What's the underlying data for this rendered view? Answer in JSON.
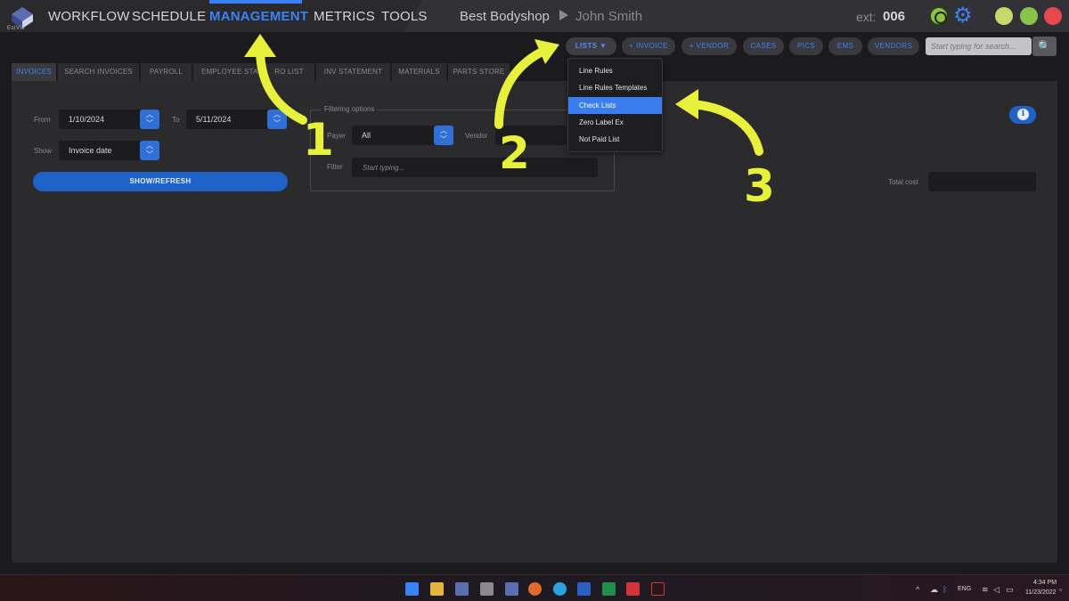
{
  "brand": {
    "logo_text": "EstVis"
  },
  "nav": {
    "items": [
      {
        "label": "WORKFLOW"
      },
      {
        "label": "SCHEDULE"
      },
      {
        "label": "MANAGEMENT"
      },
      {
        "label": "METRICS"
      },
      {
        "label": "TOOLS"
      }
    ],
    "active": "MANAGEMENT"
  },
  "header": {
    "shop": "Best Bodyshop",
    "user": "John Smith",
    "ext_label": "ext:",
    "ext_value": "006"
  },
  "toolbar": {
    "lists_label": "LISTS ▼",
    "invoice_label": "+ INVOICE",
    "vendor_label": "+ VENDOR",
    "cases_label": "CASES",
    "pics_label": "PICS",
    "ems_label": "EMS",
    "vendors_label": "VENDORS",
    "search_placeholder": "Start typing for search...",
    "search_icon": "🔍"
  },
  "tabs": [
    {
      "label": "INVOICES"
    },
    {
      "label": "SEARCH INVOICES"
    },
    {
      "label": "PAYROLL"
    },
    {
      "label": "EMPLOYEE STAT..."
    },
    {
      "label": "RO LIST"
    },
    {
      "label": "INV STATEMENT"
    },
    {
      "label": "MATERIALS"
    },
    {
      "label": "PARTS STORE"
    }
  ],
  "form": {
    "from_label": "From",
    "from_value": "1/10/2024",
    "to_label": "To",
    "to_value": "5/11/2024",
    "show_label": "Show",
    "show_value": "Invoice date",
    "show_button": "SHOW/REFRESH",
    "filtering_title": "Filtering options",
    "payer_label": "Payer",
    "payer_value": "All",
    "vendor_label": "Vendor",
    "filter_label": "Filter",
    "filter_placeholder": "Start typing...",
    "total_cost_label": "Total cost"
  },
  "lists_menu": {
    "items": [
      {
        "label": "Line Rules"
      },
      {
        "label": "Line Rules Templates"
      },
      {
        "label": "Check Lists"
      },
      {
        "label": "Zero Label Ex"
      },
      {
        "label": "Not Paid List"
      }
    ],
    "selected": "Check Lists"
  },
  "annotations": [
    "1",
    "2",
    "3"
  ],
  "system_tray": {
    "lang": "ENG",
    "time": "4:34 PM",
    "date": "11/23/2022"
  },
  "colors": {
    "accent": "#3b82f6",
    "annotation": "#e7f03a",
    "background": "#1b1b1d",
    "panel": "#2b2b2e"
  }
}
